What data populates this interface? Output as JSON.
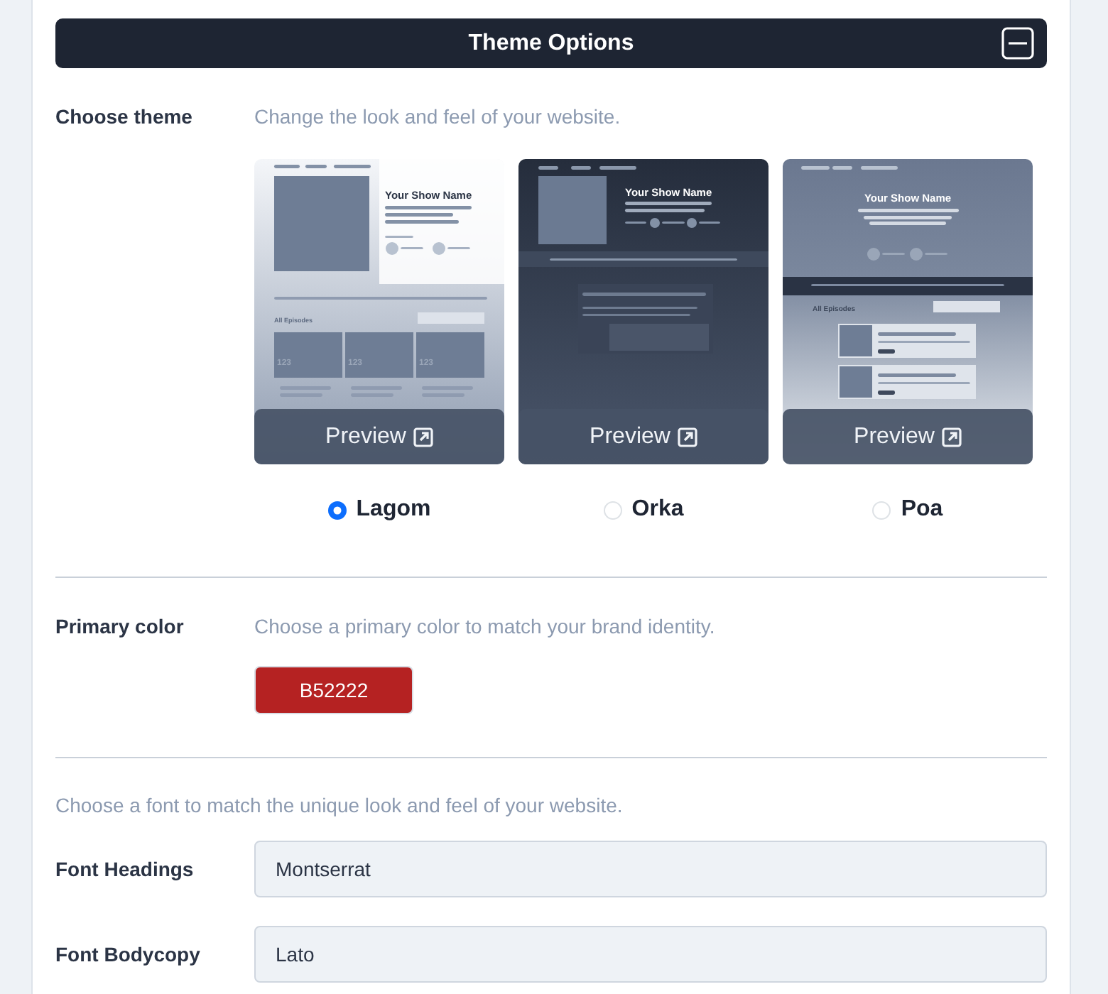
{
  "header": {
    "title": "Theme Options"
  },
  "theme_section": {
    "label": "Choose theme",
    "hint": "Change the look and feel of your website.",
    "themes": [
      {
        "name": "Lagom",
        "selected": true,
        "kind": "lagom",
        "show_name": "Your Show Name",
        "episodes_heading": "All Episodes",
        "episode_numbers": [
          "123",
          "123",
          "123"
        ],
        "preview": "Preview"
      },
      {
        "name": "Orka",
        "selected": false,
        "kind": "orka",
        "show_name": "Your Show Name",
        "preview": "Preview"
      },
      {
        "name": "Poa",
        "selected": false,
        "kind": "poa",
        "show_name": "Your Show Name",
        "episodes_heading": "All Episodes",
        "preview": "Preview"
      }
    ]
  },
  "color_section": {
    "label": "Primary color",
    "hint": "Choose a primary color to match your brand identity.",
    "value": "B52222"
  },
  "font_section": {
    "hint": "Choose a font to match the unique look and feel of your website.",
    "fields": [
      {
        "label": "Font Headings",
        "value": "Montserrat"
      },
      {
        "label": "Font Bodycopy",
        "value": "Lato"
      }
    ]
  }
}
